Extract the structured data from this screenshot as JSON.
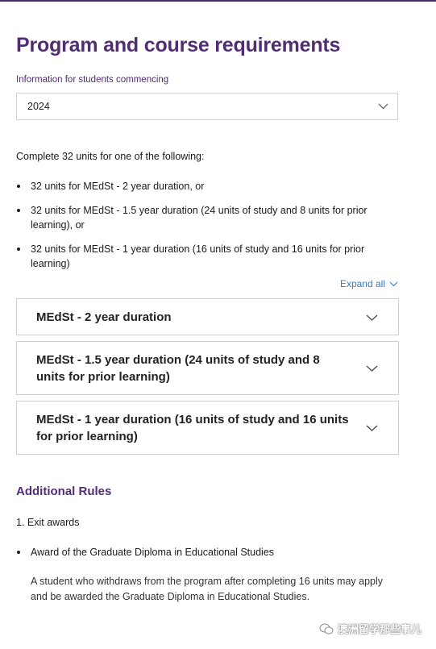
{
  "page": {
    "title": "Program and course requirements"
  },
  "commencing": {
    "label": "Information for students commencing",
    "selected": "2024"
  },
  "requirements": {
    "intro": "Complete 32 units for one of the following:",
    "options": [
      {
        "prefix": "32 units for ",
        "name": "MEdSt - 2 year duration",
        "suffix": ", or"
      },
      {
        "prefix": "32 units for ",
        "name": "MEdSt - 1.5 year duration (24 units of study and 8 units for prior learning)",
        "suffix": ", or"
      },
      {
        "prefix": "32 units for ",
        "name": "MEdSt - 1 year duration (16 units of study and 16 units for prior learning)",
        "suffix": ""
      }
    ]
  },
  "accordion": {
    "expand_all": "Expand all",
    "items": [
      {
        "title": "MEdSt - 2 year duration"
      },
      {
        "title": "MEdSt - 1.5 year duration (24 units of study and 8 units for prior learning)"
      },
      {
        "title": "MEdSt - 1 year duration (16 units of study and 16 units for prior learning)"
      }
    ]
  },
  "additional_rules": {
    "heading": "Additional Rules",
    "rule_1": "1. Exit awards",
    "award": "Award of the Graduate Diploma in Educational Studies",
    "description": "A student who withdraws from the program after completing 16 units may apply and be awarded the Graduate Diploma in Educational Studies."
  },
  "watermark": {
    "text": "澳洲留学那些事儿"
  },
  "colors": {
    "brand_purple": "#512d73",
    "link_blue": "#3b78c4",
    "border": "#cfcfcf"
  }
}
